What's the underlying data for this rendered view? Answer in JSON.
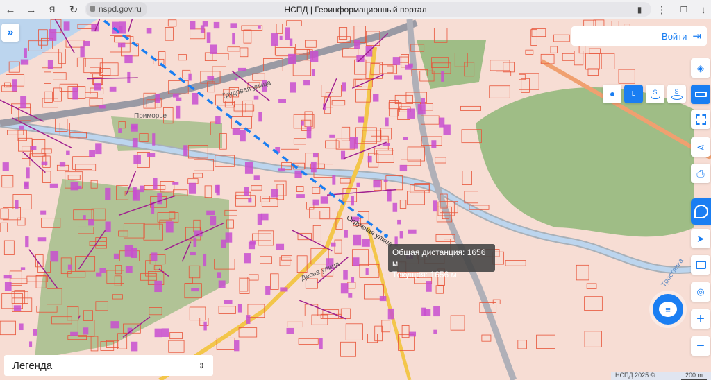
{
  "browser": {
    "url": "nspd.gov.ru",
    "title": "НСПД | Геоинформационный портал",
    "icons": [
      "back-icon",
      "forward-icon",
      "yandex-icon",
      "reload-icon",
      "lock-icon",
      "bookmark-icon",
      "menu-icon",
      "extensions-icon",
      "download-icon"
    ]
  },
  "header": {
    "login_label": "Войти"
  },
  "measure": {
    "tooltip_total": "Общая дистанция: 1656 м",
    "tooltip_current": "Текущая: 1656 м",
    "modes": [
      {
        "name": "point",
        "label": ""
      },
      {
        "name": "line",
        "label": "L",
        "active": true
      },
      {
        "name": "area",
        "label": "S"
      },
      {
        "name": "ellipse-area",
        "label": "S"
      }
    ]
  },
  "legend": {
    "label": "Легенда"
  },
  "toolbar": [
    "layers",
    "ruler",
    "select-area",
    "share",
    "print",
    "logo",
    "navigate",
    "minimap",
    "search-location",
    "zoom-in",
    "zoom-out"
  ],
  "map_labels": [
    "Трудовая улица",
    "Приморье",
    "Окружная улица",
    "Тростянка",
    "Десна улица"
  ],
  "footer": {
    "attribution": "НСПД 2025 ©",
    "scale": "200 m"
  },
  "colors": {
    "accent": "#1a7ef2",
    "parcel": "#e8553a",
    "building": "#c84fd0",
    "forest": "#9fbd86",
    "water": "#bcd5ee"
  }
}
